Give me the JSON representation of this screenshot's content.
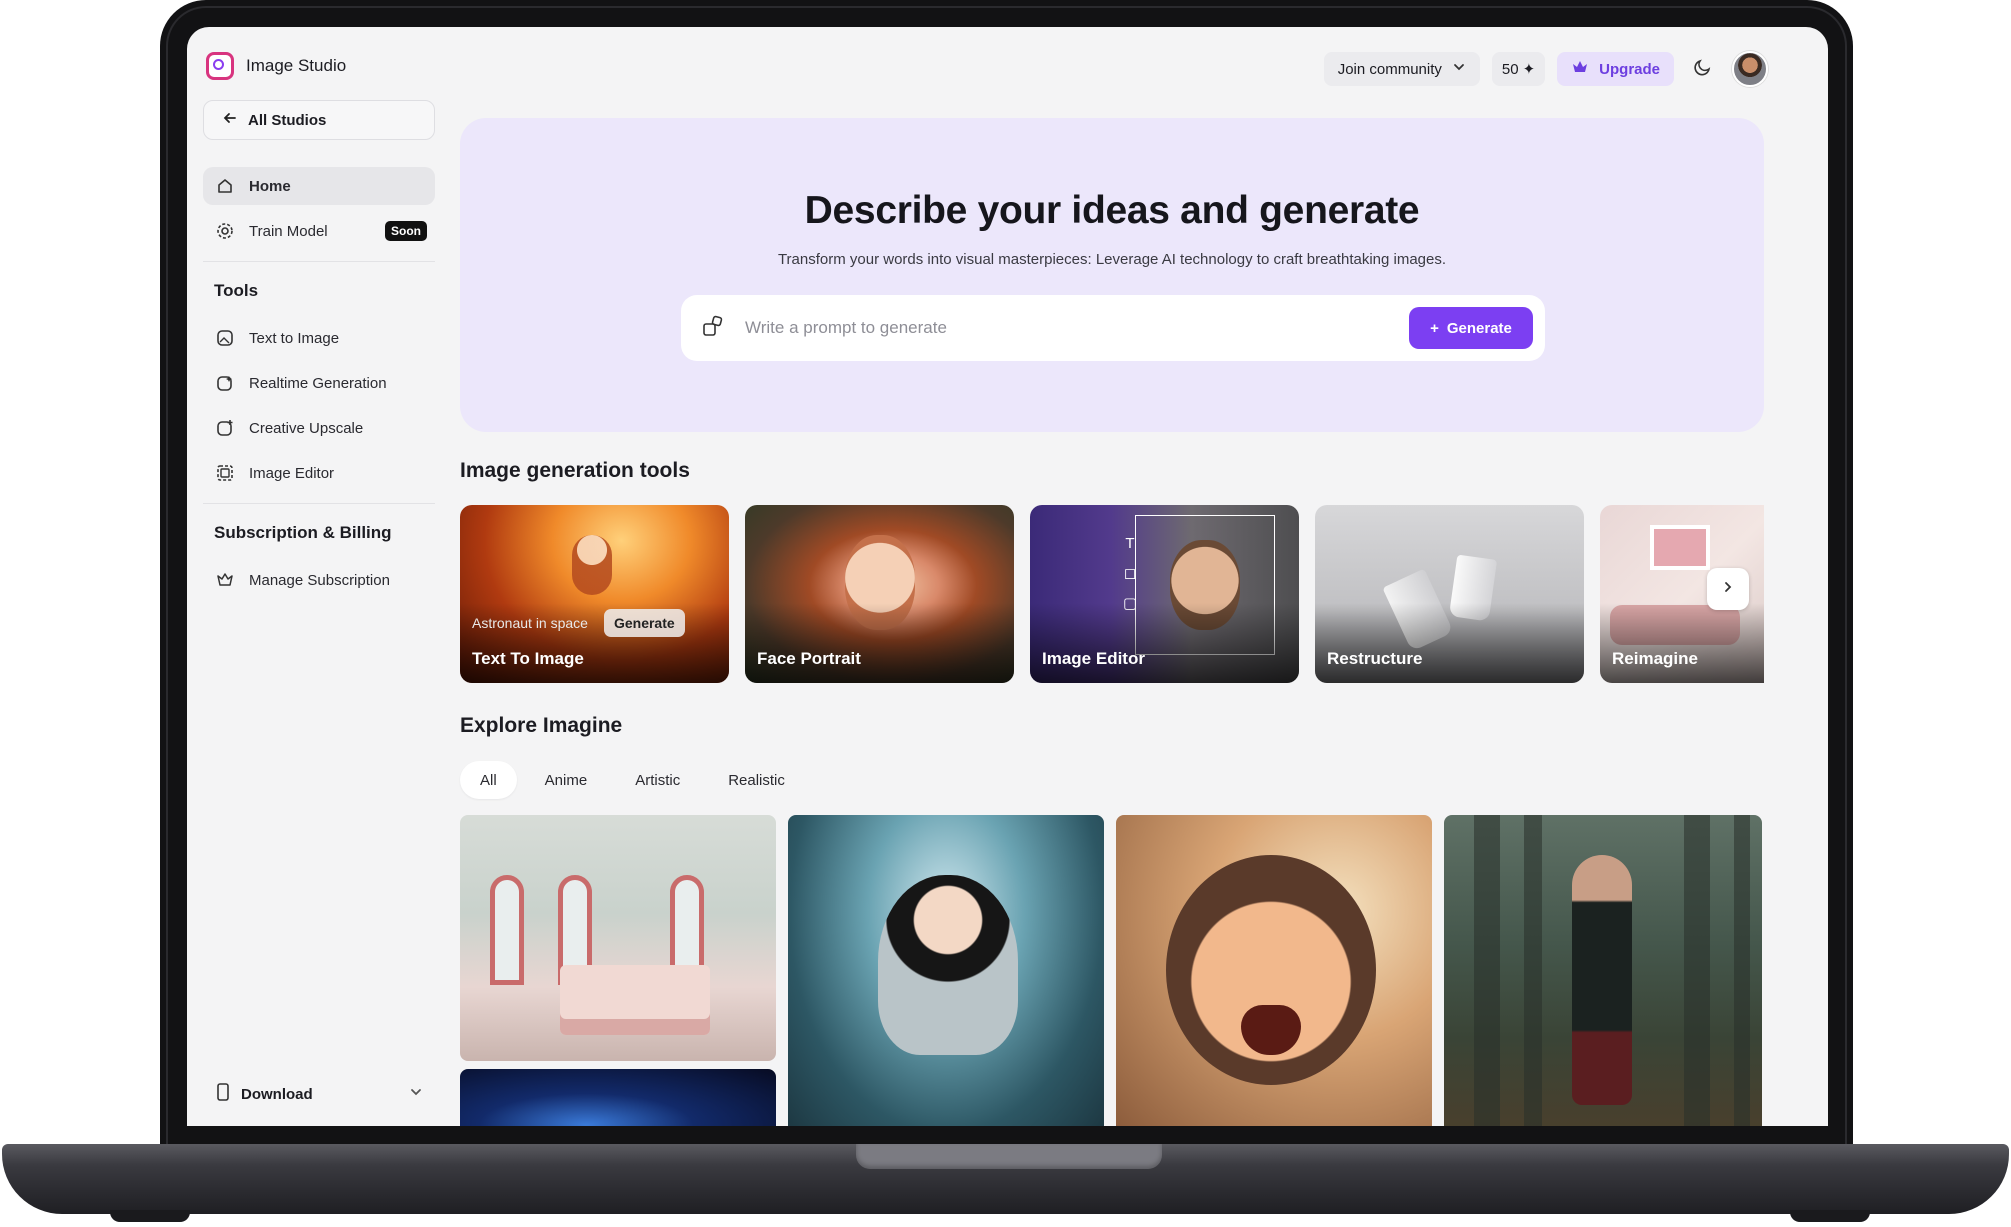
{
  "app": {
    "name": "Image Studio"
  },
  "header": {
    "community_label": "Join community",
    "credits": "50",
    "upgrade_label": "Upgrade"
  },
  "sidebar": {
    "all_studios": "All Studios",
    "nav": [
      {
        "label": "Home",
        "icon": "home-icon"
      },
      {
        "label": "Train Model",
        "icon": "gear-icon",
        "badge": "Soon"
      }
    ],
    "tools_title": "Tools",
    "tools": [
      {
        "label": "Text to Image",
        "icon": "text-image-icon"
      },
      {
        "label": "Realtime Generation",
        "icon": "realtime-icon"
      },
      {
        "label": "Creative Upscale",
        "icon": "upscale-icon"
      },
      {
        "label": "Image Editor",
        "icon": "image-editor-icon"
      }
    ],
    "billing_title": "Subscription & Billing",
    "billing": [
      {
        "label": "Manage Subscription",
        "icon": "crown-icon"
      }
    ],
    "download_label": "Download"
  },
  "hero": {
    "title": "Describe your ideas and generate",
    "subtitle": "Transform your words into visual masterpieces: Leverage AI technology to craft breathtaking images.",
    "prompt_placeholder": "Write a prompt to generate",
    "generate_label": "Generate"
  },
  "tools_section": {
    "title": "Image generation tools",
    "cards": [
      {
        "label": "Text To Image",
        "prompt_example": "Astronaut in space",
        "action": "Generate"
      },
      {
        "label": "Face Portrait"
      },
      {
        "label": "Image Editor"
      },
      {
        "label": "Restructure"
      },
      {
        "label": "Reimagine"
      }
    ]
  },
  "explore": {
    "title": "Explore Imagine",
    "filters": [
      "All",
      "Anime",
      "Artistic",
      "Realistic"
    ],
    "active_filter": "All"
  },
  "colors": {
    "accent": "#7c3ff2",
    "hero_bg": "#ece7fb",
    "upgrade_bg": "#e8e0fb"
  }
}
